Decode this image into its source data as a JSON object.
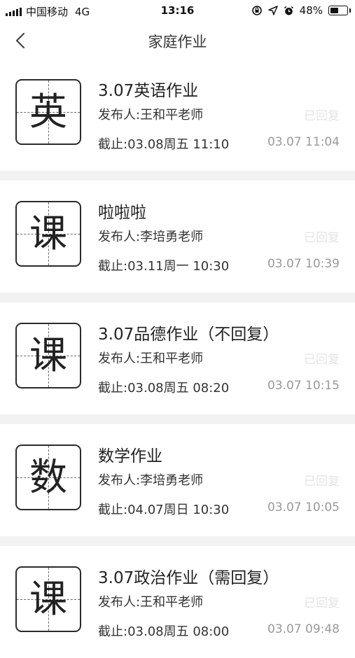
{
  "status_bar": {
    "carrier": "中国移动",
    "network": "4G",
    "time": "13:16",
    "battery": "48%"
  },
  "nav": {
    "title": "家庭作业"
  },
  "homework": [
    {
      "subject_char": "英",
      "title": "3.07英语作业",
      "publisher": "发布人:王和平老师",
      "status": "已回复",
      "deadline": "截止:03.08周五 11:10",
      "time": "03.07 11:04"
    },
    {
      "subject_char": "课",
      "title": "啦啦啦",
      "publisher": "发布人:李培勇老师",
      "status": "已回复",
      "deadline": "截止:03.11周一 10:30",
      "time": "03.07 10:39"
    },
    {
      "subject_char": "课",
      "title": "3.07品德作业（不回复）",
      "publisher": "发布人:王和平老师",
      "status": "已回复",
      "deadline": "截止:03.08周五 08:20",
      "time": "03.07 10:15"
    },
    {
      "subject_char": "数",
      "title": "数学作业",
      "publisher": "发布人:李培勇老师",
      "status": "已回复",
      "deadline": "截止:04.07周日 10:30",
      "time": "03.07 10:05"
    },
    {
      "subject_char": "课",
      "title": "3.07政治作业（需回复）",
      "publisher": "发布人:王和平老师",
      "status": "已回复",
      "deadline": "截止:03.08周五 08:00",
      "time": "03.07 09:48"
    }
  ]
}
